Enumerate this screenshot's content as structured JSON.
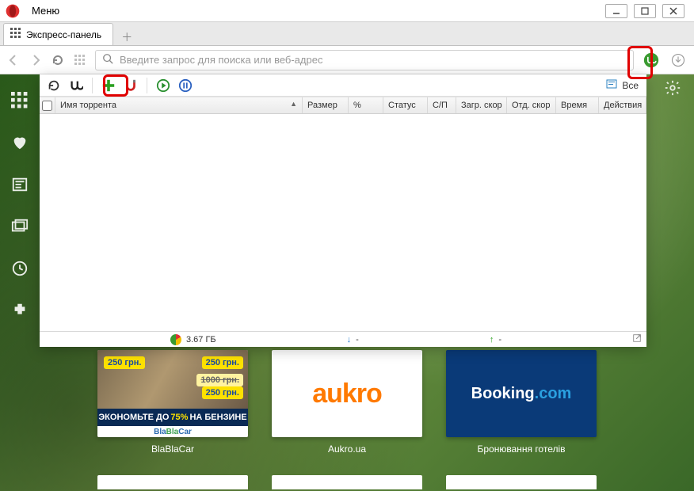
{
  "titlebar": {
    "menu_label": "Меню"
  },
  "tab": {
    "title": "Экспресс-панель"
  },
  "address": {
    "placeholder": "Введите запрос для поиска или веб-адрес"
  },
  "utorrent": {
    "filter_label": "Все",
    "columns": {
      "name": "Имя торрента",
      "size": "Размер",
      "percent": "%",
      "status": "Статус",
      "sp": "С/П",
      "dl_speed": "Загр. скор",
      "ul_speed": "Отд. скор",
      "time": "Время",
      "actions": "Действия"
    },
    "status": {
      "disk": "3.67 ГБ",
      "dl": "-",
      "ul": "-"
    }
  },
  "tiles": [
    {
      "label": "BlaBlaCar",
      "inner": {
        "badge1": "250 грн.",
        "badge1b": "250 грн.",
        "badge2": "1000 грн.",
        "badge3": "250 грн.",
        "strip_pre": "ЭКОНОМЬТЕ ДО ",
        "strip_pct": "75%",
        "strip_post": " НА БЕНЗИНЕ",
        "brand_bla": "Bla",
        "brand_car": "Car"
      }
    },
    {
      "label": "Aukro.ua",
      "logo_text": "aukro"
    },
    {
      "label": "Бронювання готелів",
      "logo_pre": "Booking",
      "logo_post": ".com"
    }
  ]
}
